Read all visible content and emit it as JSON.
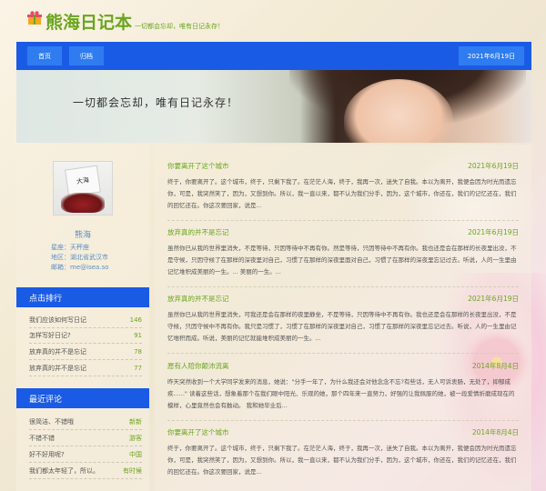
{
  "header": {
    "title": "熊海日记本",
    "slogan": "一切都会忘却，唯有日记永存！"
  },
  "nav": {
    "items": [
      {
        "label": "首页"
      },
      {
        "label": "归档"
      }
    ],
    "date": "2021年6月19日"
  },
  "banner": {
    "text": "一切都会忘却，唯有日记永存！"
  },
  "profile": {
    "avatar_text": "大海",
    "name": "熊海",
    "constellation": "星座：天秤座",
    "region": "地区：湖北省武汉市",
    "email": "邮箱：me@isea.so"
  },
  "ranking": {
    "heading": "点击排行",
    "items": [
      {
        "title": "我们应该如何写日记",
        "count": "146"
      },
      {
        "title": "怎样写好日记?",
        "count": "91"
      },
      {
        "title": "放弃真的并不是忘记",
        "count": "78"
      },
      {
        "title": "放弃真的并不是忘记",
        "count": "77"
      }
    ]
  },
  "comments": {
    "heading": "最近评论",
    "items": [
      {
        "text": "很简洁、不错哦",
        "author": "新新"
      },
      {
        "text": "不错不错",
        "author": "游客"
      },
      {
        "text": "好不好用呢?",
        "author": "中国"
      },
      {
        "text": "我们都太年轻了，所以。",
        "author": "有时候"
      }
    ]
  },
  "articles": [
    {
      "title": "你要离开了这个城市",
      "date": "2021年6月19日",
      "body": "终于，你要离开了。这个城市，终于，只剩下我了。在茫茫人海，终于，我再一次，迷失了自我。本以为离开，我便会因为时光而遗忘你，可是，我突然笑了，因为，又想到你。所以，我一直以来，都不认为我们分手，因为，这个城市，你还在，我们的记忆还在，我们的回忆还在。你这次要回家，说是..."
    },
    {
      "title": "放弃真的并不是忘记",
      "date": "2021年6月19日",
      "body": "虽然你已从我的世界里消失，不是等待，只因等待中不再有你。然是等待，只因等待中不再有你。我也还是会在那样的长夜里出没，不是守候，只因守候了在那样的深夜里对自己，习惯了在那样的深夜里面对自己，习惯了在那样的深夜里忘记过去。听说，人的一生里由记忆堆积成美丽的一生。... 美丽的一生。..."
    },
    {
      "title": "放弃真的并不是忘记",
      "date": "2021年6月19日",
      "body": "虽然你已从我的世界里消失，可我还是会在那样的夜里静坐，不是等待，只因等待中不再有你。我也还是会在那样的长夜里出没，不是守候，只因守候中不再有你。我只是习惯了，习惯了在那样的深夜里对自己，习惯了在那样的深夜里忘记过去。听说，人的一生里由记忆堆积而成。听说，美丽的记忆就能堆积成美丽的一生。..."
    },
    {
      "title": "愿有人陪你颠沛流离",
      "date": "2014年8月4日",
      "body": "昨天突然收到一个大学同学发来的消息，她说：\"分手一年了，为什么我还会对他念念不忘?有些话，无人可诉衷肠，无处了，抑郁成疾......\" 读着这些话，想象着那个在我们眼中阳光、乐观的她，那个四年来一直努力，好强的让我佩服的她，被一段爱情折磨成现在的模样，心里竟然也会有触动。 我和她毕业后..."
    },
    {
      "title": "你要离开了这个城市",
      "date": "2014年8月4日",
      "body": "终于，你要离开了。这个城市，终于，只剩下我了。在茫茫人海，终于，我再一次，迷失了自我。本以为离开，我便会因为时光而遗忘你，可是，我突然笑了，因为，又想到你。所以，我一直以来，都不认为我们分手，因为，这个城市，你还在，我们的记忆还在，我们的回忆还在。你这次要回家，说是..."
    }
  ]
}
